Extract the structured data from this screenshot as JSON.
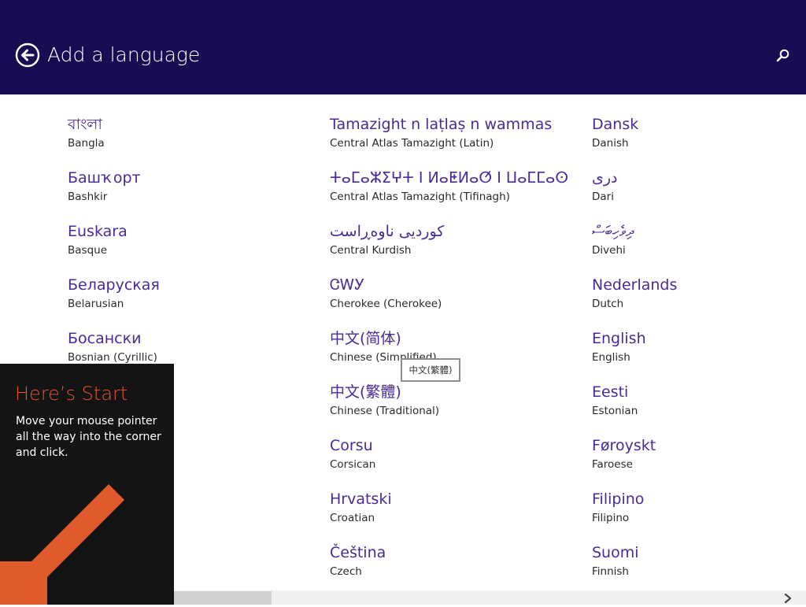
{
  "header": {
    "title": "Add a language",
    "background": "#180c52",
    "back_icon": "back-arrow-circle-icon",
    "search_icon": "search-icon"
  },
  "languages": {
    "column1": [
      {
        "native": "বাংলা",
        "english": "Bangla"
      },
      {
        "native": "Башҡорт",
        "english": "Bashkir"
      },
      {
        "native": "Euskara",
        "english": "Basque"
      },
      {
        "native": "Беларуская",
        "english": "Belarusian"
      },
      {
        "native": "Босански",
        "english": "Bosnian (Cyrillic)"
      }
    ],
    "column2": [
      {
        "native": "Tamazight n laṭlaṣ n wammas",
        "english": "Central Atlas Tamazight (Latin)"
      },
      {
        "native": "ⵜⴰⵎⴰⵣⵉⵖⵜ ⵏ ⵍⴰⵟⵍⴰⵚ ⵏ ⵡⴰⵎⵎⴰⵙ",
        "english": "Central Atlas Tamazight (Tifinagh)"
      },
      {
        "native": "کوردیی ناوەڕاست",
        "english": "Central Kurdish"
      },
      {
        "native": "ᏣᎳᎩ",
        "english": "Cherokee (Cherokee)"
      },
      {
        "native": "中文(简体)",
        "english": "Chinese (Simplified)"
      },
      {
        "native": "中文(繁體)",
        "english": "Chinese (Traditional)"
      },
      {
        "native": "Corsu",
        "english": "Corsican"
      },
      {
        "native": "Hrvatski",
        "english": "Croatian"
      },
      {
        "native": "Čeština",
        "english": "Czech"
      }
    ],
    "column3": [
      {
        "native": "Dansk",
        "english": "Danish"
      },
      {
        "native": "دری",
        "english": "Dari"
      },
      {
        "native": "ދިވެހިބަސް",
        "english": "Divehi"
      },
      {
        "native": "Nederlands",
        "english": "Dutch"
      },
      {
        "native": "English",
        "english": "English"
      },
      {
        "native": "Eesti",
        "english": "Estonian"
      },
      {
        "native": "Føroyskt",
        "english": "Faroese"
      },
      {
        "native": "Filipino",
        "english": "Filipino"
      },
      {
        "native": "Suomi",
        "english": "Finnish"
      }
    ]
  },
  "tooltip": {
    "text": "中文(繁體)"
  },
  "start_hint": {
    "title": "Here’s Start",
    "body": "Move your mouse pointer all the way into the corner and click.",
    "title_color": "#e8542a",
    "arrow_color": "#e05a2b",
    "arrow_icon": "diagonal-arrow-icon"
  },
  "scrollbar": {
    "right_icon": "chevron-right-icon"
  },
  "colors": {
    "native_text": "#4b2a97",
    "english_text": "#2a2a2a",
    "hover_bg": "#f0f0f0"
  }
}
